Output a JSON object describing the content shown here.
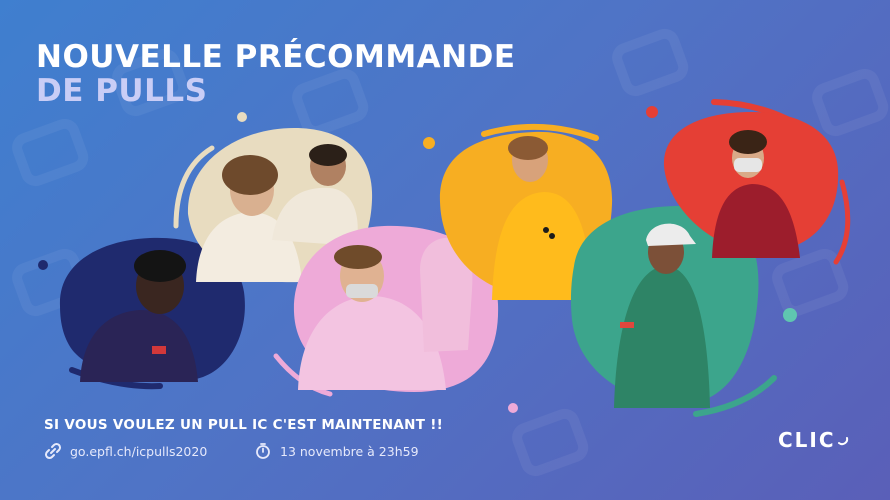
{
  "title": {
    "line1": "NOUVELLE PRÉCOMMANDE",
    "line2": "DE PULLS"
  },
  "tagline": "SI VOUS VOULEZ UN PULL IC C'EST MAINTENANT !!",
  "link": {
    "icon": "link-icon",
    "text": "go.epfl.ch/icpulls2020"
  },
  "deadline": {
    "icon": "stopwatch-icon",
    "text": "13 novembre à 23h59"
  },
  "logo": {
    "text": "CLIC"
  },
  "colors": {
    "navy": "#1f2a6e",
    "cream": "#e8dcc0",
    "pink": "#eeaad8",
    "yellow": "#f7ae22",
    "green": "#3ca58c",
    "red": "#e53f35"
  }
}
